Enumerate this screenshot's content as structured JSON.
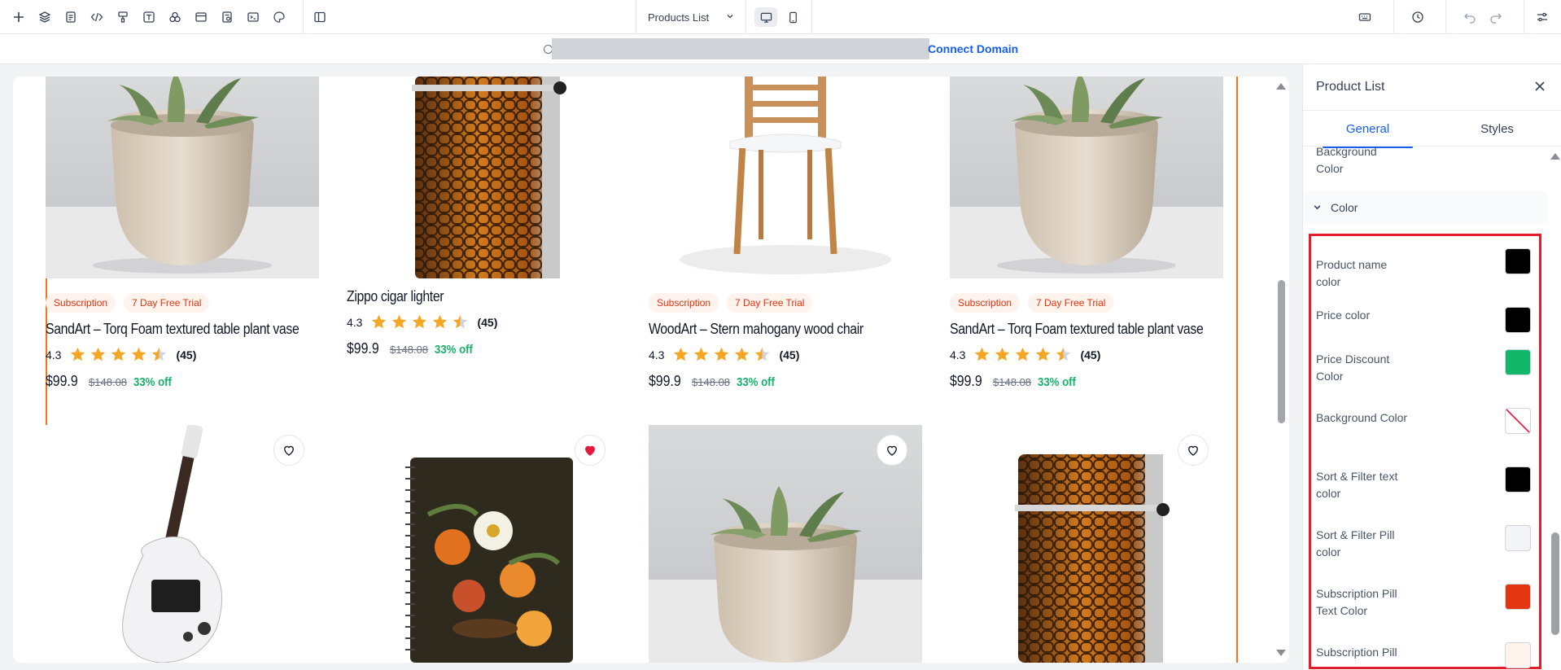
{
  "toolbar": {
    "icons": [
      "plus-icon",
      "layers-icon",
      "page-icon",
      "code-icon",
      "paint-icon",
      "text-icon",
      "shapes-icon",
      "layout-icon",
      "form-icon",
      "terminal-icon",
      "palette-icon",
      "split-view-icon"
    ],
    "page_selector": "Products List",
    "right_icons": [
      "keyboard-icon",
      "history-icon",
      "undo-icon",
      "redo-icon",
      "settings-sliders-icon"
    ]
  },
  "urlbar": {
    "connect_label": "Connect Domain"
  },
  "colors": {
    "accent": "#155eef",
    "outline": "#f97316",
    "pill_text": "#e3350f",
    "pill_bg": "#fff3ee",
    "discount": "#17b26a",
    "star": "#f5a623",
    "highlight": "#e11d2e"
  },
  "products_row1": [
    {
      "pills": [
        "Subscription",
        "7 Day Free Trial"
      ],
      "name": "SandArt – Torq Foam textured table plant vase",
      "rating": "4.3",
      "stars": 4.5,
      "count": "(45)",
      "price": "$99.9",
      "old_price": "$148.08",
      "discount": "33% off"
    },
    {
      "pills": [],
      "name": "Zippo cigar lighter",
      "rating": "4.3",
      "stars": 4.5,
      "count": "(45)",
      "price": "$99.9",
      "old_price": "$148.08",
      "discount": "33% off"
    },
    {
      "pills": [
        "Subscription",
        "7 Day Free Trial"
      ],
      "name": "WoodArt – Stern mahogany wood chair",
      "rating": "4.3",
      "stars": 4.5,
      "count": "(45)",
      "price": "$99.9",
      "old_price": "$148.08",
      "discount": "33% off"
    },
    {
      "pills": [
        "Subscription",
        "7 Day Free Trial"
      ],
      "name": "SandArt – Torq Foam textured table plant vase",
      "rating": "4.3",
      "stars": 4.5,
      "count": "(45)",
      "price": "$99.9",
      "old_price": "$148.08",
      "discount": "33% off"
    }
  ],
  "products_row2": [
    {
      "image": "guitar",
      "favorited": false
    },
    {
      "image": "notebook",
      "favorited": true
    },
    {
      "image": "plant-vase",
      "favorited": false
    },
    {
      "image": "lighter",
      "favorited": false
    }
  ],
  "panel": {
    "title": "Product List",
    "tabs": [
      "General",
      "Styles"
    ],
    "active_tab": "General",
    "top_partial_label": "Background Color",
    "section_title": "Color",
    "color_props": [
      {
        "label": "Product name color",
        "value": "#000000"
      },
      {
        "label": "Price color",
        "value": "#000000"
      },
      {
        "label": "Price Discount Color",
        "value": "#12b76a"
      },
      {
        "label": "Background Color",
        "value": "transparent"
      },
      {
        "label": "Sort & Filter text color",
        "value": "#000000"
      },
      {
        "label": "Sort & Filter Pill color",
        "value": "#f2f4f7"
      },
      {
        "label": "Subscription Pill Text Color",
        "value": "#e3350f"
      },
      {
        "label": "Subscription Pill",
        "value": "#fff3ee"
      }
    ]
  }
}
